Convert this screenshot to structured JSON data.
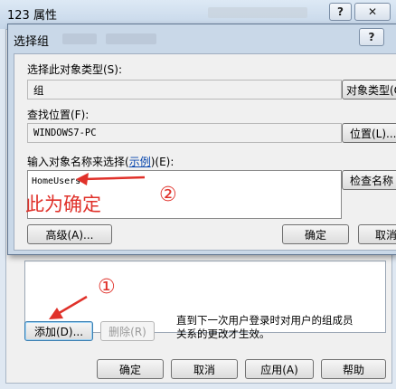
{
  "parent_window": {
    "title": "123 属性",
    "help_button": "?",
    "close_button": "✕",
    "add_button": "添加(D)...",
    "remove_button": "删除(R)",
    "note": "直到下一次用户登录时对用户的组成员关系的更改才生效。",
    "ok_button": "确定",
    "cancel_button": "取消",
    "apply_button": "应用(A)",
    "help_footer_button": "帮助"
  },
  "dialog": {
    "title": "选择组",
    "help_button": "?",
    "object_type_label": "选择此对象类型(S):",
    "object_type_value": "组",
    "object_type_button": "对象类型(O)",
    "location_label": "查找位置(F):",
    "location_value": "WINDOWS7-PC",
    "location_button": "位置(L)...",
    "names_label_prefix": "输入对象名称来选择(",
    "names_label_link": "示例",
    "names_label_suffix": ")(E):",
    "names_value": "HomeUsers",
    "check_names_button": "检查名称",
    "advanced_button": "高级(A)...",
    "ok_button": "确定",
    "cancel_button": "取消"
  },
  "annotations": {
    "circle_1": "①",
    "circle_2": "②",
    "note_text": "此为确定",
    "color": "#e0312a"
  }
}
